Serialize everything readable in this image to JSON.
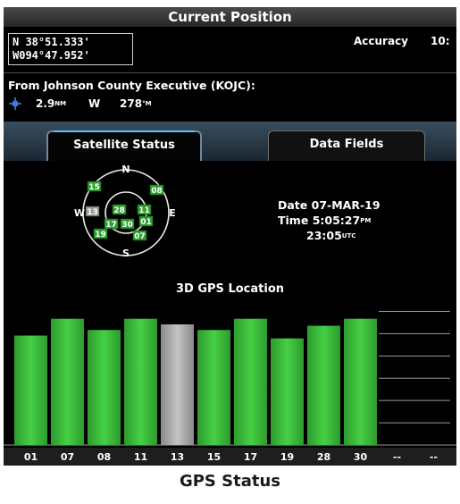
{
  "header": {
    "title": "Current Position"
  },
  "position": {
    "lat": "N  38°51.333'",
    "lon": "W094°47.952'",
    "accuracy_label": "Accuracy",
    "accuracy_value": "10:"
  },
  "from": {
    "label": "From Johnson County Executive (KOJC):",
    "distance": "2.9",
    "distance_unit": "NM",
    "direction": "W",
    "bearing": "278",
    "bearing_unit": "°M"
  },
  "tabs": [
    {
      "label": "Satellite Status",
      "active": true
    },
    {
      "label": "Data Fields",
      "active": false
    }
  ],
  "sky": {
    "north": "N",
    "south": "S",
    "east": "E",
    "west": "W",
    "satellites": [
      {
        "id": "15",
        "status": "used"
      },
      {
        "id": "08",
        "status": "used"
      },
      {
        "id": "13",
        "status": "not-used"
      },
      {
        "id": "28",
        "status": "used"
      },
      {
        "id": "11",
        "status": "used"
      },
      {
        "id": "01",
        "status": "used"
      },
      {
        "id": "17",
        "status": "used"
      },
      {
        "id": "30",
        "status": "used"
      },
      {
        "id": "19",
        "status": "used"
      },
      {
        "id": "07",
        "status": "used"
      }
    ]
  },
  "datetime": {
    "date_label": "Date",
    "date": "07-MAR-19",
    "time_label": "Time",
    "local_time": "5:05:27",
    "local_suffix": "PM",
    "utc_time": "23:05",
    "utc_suffix": "UTC"
  },
  "location_label": "3D GPS Location",
  "chart_data": {
    "type": "bar",
    "categories": [
      "01",
      "07",
      "08",
      "11",
      "13",
      "15",
      "17",
      "19",
      "28",
      "30",
      "--",
      "--"
    ],
    "values": [
      0.78,
      0.9,
      0.82,
      0.9,
      0.86,
      0.82,
      0.9,
      0.76,
      0.85,
      0.9,
      0,
      0
    ],
    "status": [
      "used",
      "used",
      "used",
      "used",
      "not-used",
      "used",
      "used",
      "used",
      "used",
      "used",
      "none",
      "none"
    ],
    "ylim": [
      0,
      1
    ],
    "colors": {
      "used": "#3cbf3c",
      "not-used": "#a8a8a8"
    }
  },
  "caption": "GPS Status"
}
